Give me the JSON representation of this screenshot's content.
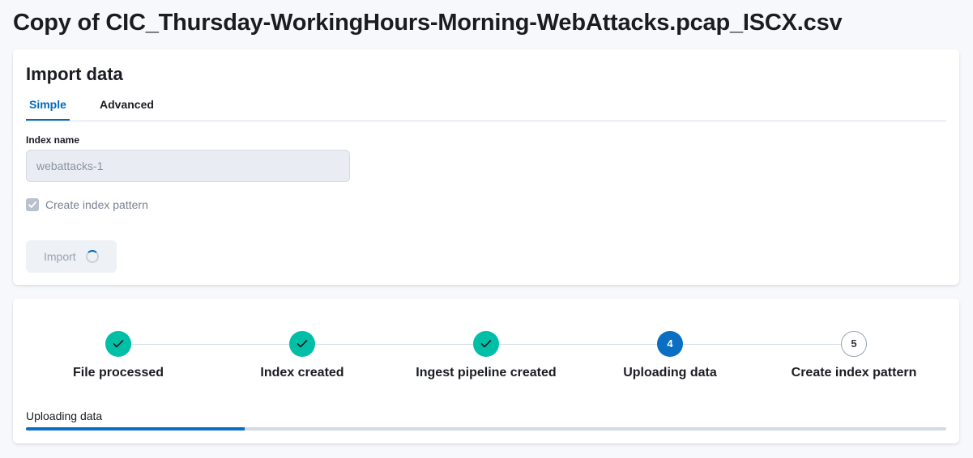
{
  "page": {
    "title": "Copy of CIC_Thursday-WorkingHours-Morning-WebAttacks.pcap_ISCX.csv"
  },
  "import_panel": {
    "heading": "Import data",
    "tabs": [
      {
        "label": "Simple",
        "active": true
      },
      {
        "label": "Advanced",
        "active": false
      }
    ],
    "index_name": {
      "label": "Index name",
      "value": "webattacks-1"
    },
    "create_index_pattern": {
      "label": "Create index pattern",
      "checked": true
    },
    "import_button": {
      "label": "Import",
      "loading": true
    }
  },
  "steps_panel": {
    "steps": [
      {
        "label": "File processed",
        "status": "complete",
        "number": "1"
      },
      {
        "label": "Index created",
        "status": "complete",
        "number": "2"
      },
      {
        "label": "Ingest pipeline created",
        "status": "complete",
        "number": "3"
      },
      {
        "label": "Uploading data",
        "status": "current",
        "number": "4"
      },
      {
        "label": "Create index pattern",
        "status": "incomplete",
        "number": "5"
      }
    ],
    "progress": {
      "label": "Uploading data",
      "percent": 23.8
    }
  },
  "colors": {
    "accent": "#006bb8",
    "complete": "#00bfa6",
    "current": "#0a6fc2"
  },
  "icons": {
    "step_complete": "check-icon",
    "loading": "spinner-icon"
  }
}
